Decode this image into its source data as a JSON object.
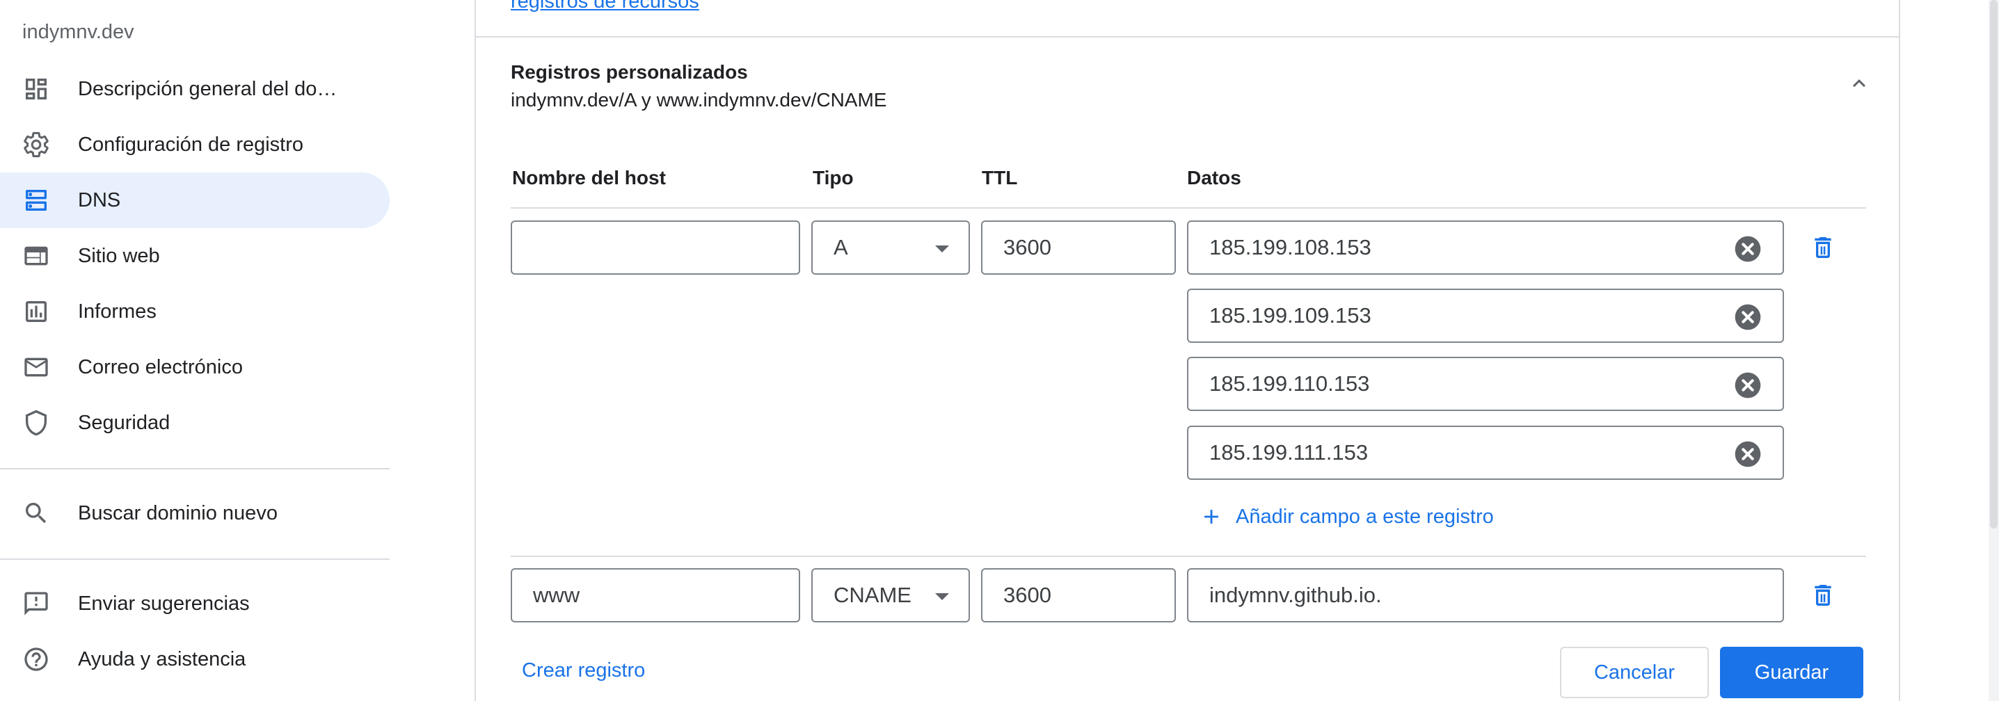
{
  "sidebar": {
    "domain": "indymnv.dev",
    "items": [
      {
        "label": "Descripción general del do…",
        "icon": "dashboard-icon"
      },
      {
        "label": "Configuración de registro",
        "icon": "gear-icon"
      },
      {
        "label": "DNS",
        "icon": "dns-icon"
      },
      {
        "label": "Sitio web",
        "icon": "web-icon"
      },
      {
        "label": "Informes",
        "icon": "bar-chart-icon"
      },
      {
        "label": "Correo electrónico",
        "icon": "mail-icon"
      },
      {
        "label": "Seguridad",
        "icon": "shield-icon"
      }
    ],
    "search_label": "Buscar dominio nuevo",
    "feedback_label": "Enviar sugerencias",
    "help_label": "Ayuda y asistencia"
  },
  "main": {
    "top_link": "registros de recursos",
    "section_title": "Registros personalizados",
    "section_subtitle": "indymnv.dev/A y www.indymnv.dev/CNAME",
    "headers": {
      "host": "Nombre del host",
      "type": "Tipo",
      "ttl": "TTL",
      "data": "Datos"
    },
    "record_a": {
      "host": "",
      "type": "A",
      "ttl": "3600",
      "data": [
        "185.199.108.153",
        "185.199.109.153",
        "185.199.110.153",
        "185.199.111.153"
      ]
    },
    "add_field_label": "Añadir campo a este registro",
    "record_cname": {
      "host": "www",
      "type": "CNAME",
      "ttl": "3600",
      "data": "indymnv.github.io."
    },
    "create_label": "Crear registro",
    "cancel_label": "Cancelar",
    "save_label": "Guardar"
  },
  "colors": {
    "accent": "#1a73e8",
    "active_bg": "#e8f0fe",
    "border": "#dadce0"
  }
}
